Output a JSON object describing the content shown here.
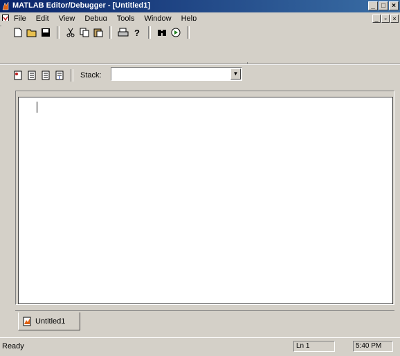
{
  "window": {
    "title": "MATLAB Editor/Debugger - [Untitled1]",
    "minimize_glyph": "_",
    "maximize_glyph": "□",
    "close_glyph": "×"
  },
  "menubar": {
    "items": [
      "File",
      "Edit",
      "View",
      "Debug",
      "Tools",
      "Window",
      "Help"
    ],
    "mdi_minimize_glyph": "_",
    "mdi_restore_glyph": "▫",
    "mdi_close_glyph": "×"
  },
  "toolbar": {
    "row1_icons": [
      "new-file-icon",
      "open-folder-icon",
      "save-icon",
      "cut-icon",
      "copy-icon",
      "paste-icon",
      "print-icon",
      "help-icon",
      "find-icon",
      "run-icon"
    ],
    "row2_icons": [
      "set-breakpoint-icon",
      "clear-breakpoint-icon",
      "step-icon",
      "step-in-icon"
    ],
    "stack_label": "Stack:",
    "stack_value": ""
  },
  "editor": {
    "content": ""
  },
  "tabs": [
    {
      "label": "Untitled1"
    }
  ],
  "statusbar": {
    "status": "Ready",
    "line": "Ln 1",
    "time": "5:40 PM"
  },
  "colors": {
    "titlebar_start": "#0a246a",
    "titlebar_end": "#3a6ea5",
    "chrome": "#d4d0c8"
  }
}
